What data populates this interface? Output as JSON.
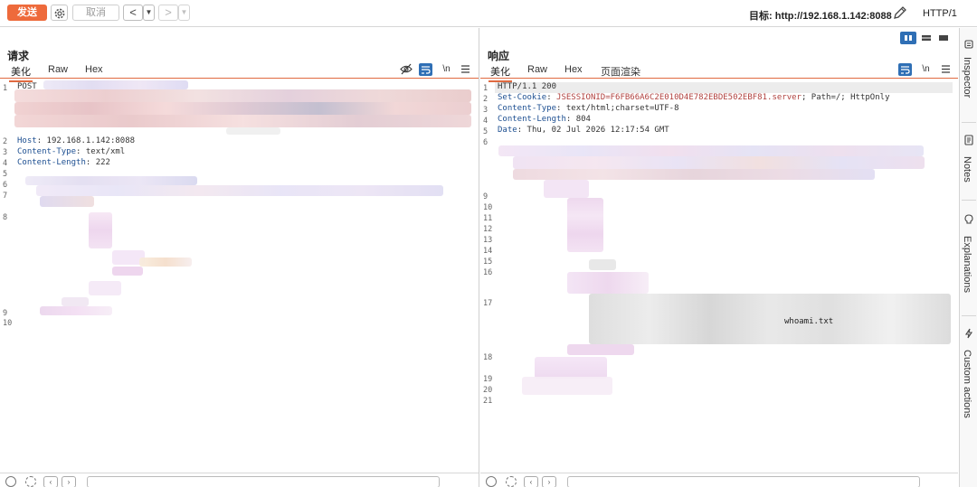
{
  "toolbar": {
    "send_label": "发送",
    "cancel_label": "取消",
    "back_label": "<",
    "forward_label": ">",
    "target_label": "目标: http://192.168.1.142:8088",
    "protocol_label": "HTTP/1"
  },
  "request": {
    "title": "请求",
    "tabs": [
      "美化",
      "Raw",
      "Hex"
    ],
    "tools": [
      "eye-off-icon",
      "wrap-icon",
      "\\n",
      "menu-icon"
    ],
    "lines": [
      {
        "n": "1",
        "text": "POST"
      },
      {
        "n": "2",
        "name": "Host",
        "value": " 192.168.1.142:8088"
      },
      {
        "n": "3",
        "name": "Content-Type",
        "value": " text/xml"
      },
      {
        "n": "4",
        "name": "Content-Length",
        "value": " 222"
      },
      {
        "n": "5",
        "text": ""
      },
      {
        "n": "6",
        "text": ""
      },
      {
        "n": "7",
        "text": ""
      },
      {
        "n": "8",
        "text": ""
      },
      {
        "n": "9",
        "text": ""
      },
      {
        "n": "10",
        "text": ""
      }
    ]
  },
  "response": {
    "title": "响应",
    "tabs": [
      "美化",
      "Raw",
      "Hex",
      "页面渲染"
    ],
    "tools": [
      "wrap-icon",
      "\\n",
      "menu-icon"
    ],
    "lines": [
      {
        "n": "1",
        "text": "HTTP/1.1 200"
      },
      {
        "n": "2",
        "name": "Set-Cookie",
        "value": " JSESSIONID=F6FB66A6C2E010D4E782EBDE502EBF81.server",
        "rest": "; Path=/; HttpOnly"
      },
      {
        "n": "3",
        "name": "Content-Type",
        "value": " text/html;charset=UTF-8"
      },
      {
        "n": "4",
        "name": "Content-Length",
        "value": " 804"
      },
      {
        "n": "5",
        "name": "Date",
        "value": " Thu, 02 Jul 2026 12:17:54 GMT"
      },
      {
        "n": "6",
        "text": ""
      },
      {
        "n": "9",
        "text": ""
      },
      {
        "n": "10",
        "text": ""
      },
      {
        "n": "11",
        "text": ""
      },
      {
        "n": "12",
        "text": ""
      },
      {
        "n": "13",
        "text": ""
      },
      {
        "n": "14",
        "text": ""
      },
      {
        "n": "15",
        "text": ""
      },
      {
        "n": "16",
        "text": ""
      },
      {
        "n": "17",
        "text": "whoami.txt"
      },
      {
        "n": "18",
        "text": ""
      },
      {
        "n": "19",
        "text": ""
      },
      {
        "n": "20",
        "text": ""
      },
      {
        "n": "21",
        "text": ""
      }
    ]
  },
  "sidebar": {
    "items": [
      "Inspector",
      "Notes",
      "Explanations",
      "Custom actions"
    ]
  },
  "colors": {
    "accent": "#ee6a3b",
    "toggle": "#2f6fb5",
    "header_name": "#1d4f91",
    "cookie_value": "#b0413e"
  }
}
